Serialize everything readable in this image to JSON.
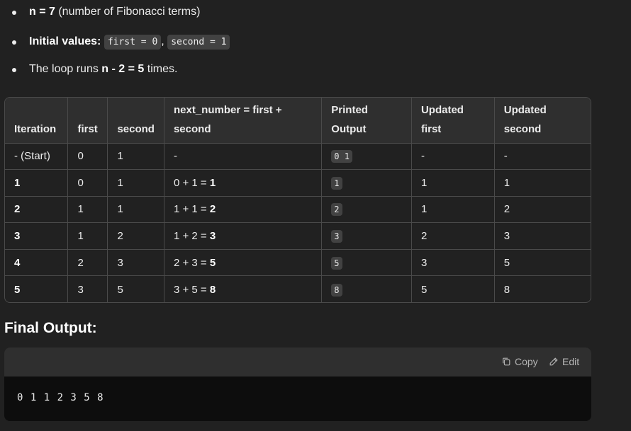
{
  "bullets": {
    "n_label": "n = 7",
    "n_desc": " (number of Fibonacci terms)",
    "init_label": "Initial values:",
    "init_first": "first = 0",
    "init_sep": ",",
    "init_second": "second = 1",
    "loop_pre": "The loop runs ",
    "loop_bold": "n - 2 = 5",
    "loop_post": " times."
  },
  "table": {
    "headers": [
      "Iteration",
      "first",
      "second",
      "next_number = first + second",
      "Printed Output",
      "Updated first",
      "Updated second"
    ],
    "rows": [
      [
        "- (Start)",
        "0",
        "1",
        "-",
        "0 1",
        "-",
        "-"
      ],
      [
        "1",
        "0",
        "1",
        "0 + 1 = ",
        "1",
        "1",
        "1"
      ],
      [
        "2",
        "1",
        "1",
        "1 + 1 = ",
        "2",
        "1",
        "2"
      ],
      [
        "3",
        "1",
        "2",
        "1 + 2 = ",
        "3",
        "2",
        "3"
      ],
      [
        "4",
        "2",
        "3",
        "2 + 3 = ",
        "5",
        "3",
        "5"
      ],
      [
        "5",
        "3",
        "5",
        "3 + 5 = ",
        "8",
        "5",
        "8"
      ]
    ],
    "next_results": [
      "",
      "1",
      "2",
      "3",
      "5",
      "8"
    ]
  },
  "final_output": {
    "title": "Final Output:",
    "copy_label": "Copy",
    "edit_label": "Edit",
    "code": "0 1 1 2 3 5 8"
  },
  "icons": {
    "copy": "copy-icon",
    "edit": "pencil-icon"
  },
  "colors": {
    "background": "#212121",
    "table_header": "#2f2f2f",
    "code_bg": "#0d0d0d",
    "inline_code_bg": "#424242",
    "border": "#4a4a4a"
  }
}
